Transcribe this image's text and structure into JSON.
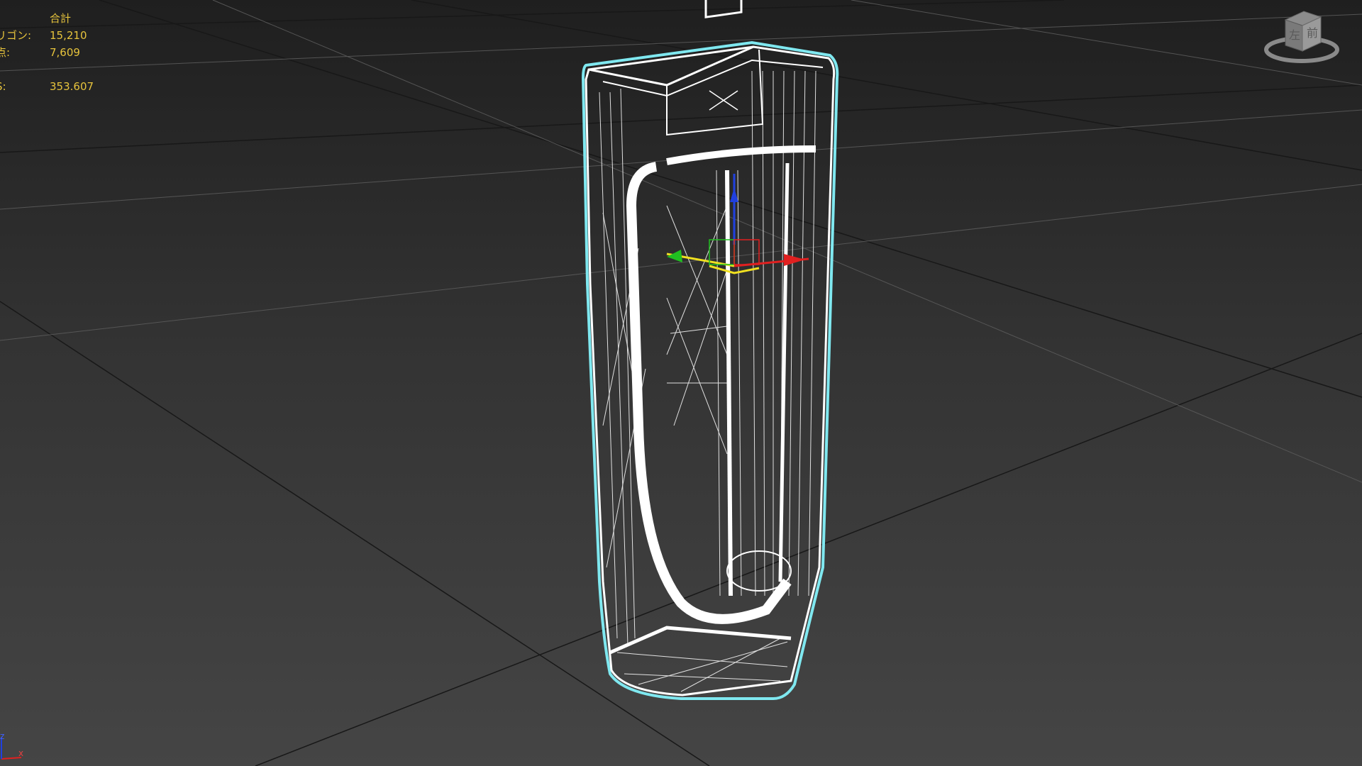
{
  "viewport": {
    "background_top": "#1f1f1f",
    "background_bottom": "#454545",
    "grid_color": "#1a1a1a",
    "grid_highlight_color": "#7a7a7a",
    "wire_color": "#ffffff",
    "selection_outline_color": "#7fe8f0"
  },
  "stats": {
    "header": "合計",
    "rows": [
      {
        "label": "リゴン:",
        "value": "15,210"
      },
      {
        "label": "点:",
        "value": "7,609"
      },
      {
        "label": "",
        "value": ""
      },
      {
        "label": "S:",
        "value": "353.607"
      }
    ],
    "text_color": "#e6c33c"
  },
  "viewcube": {
    "face_left": "左",
    "face_front": "前"
  },
  "gizmo": {
    "x_color": "#e02020",
    "y_color": "#20c020",
    "z_color": "#2040e0",
    "plane_color": "#f0e020"
  },
  "axis_tripod": {
    "x_label": "x",
    "z_label": "z"
  }
}
